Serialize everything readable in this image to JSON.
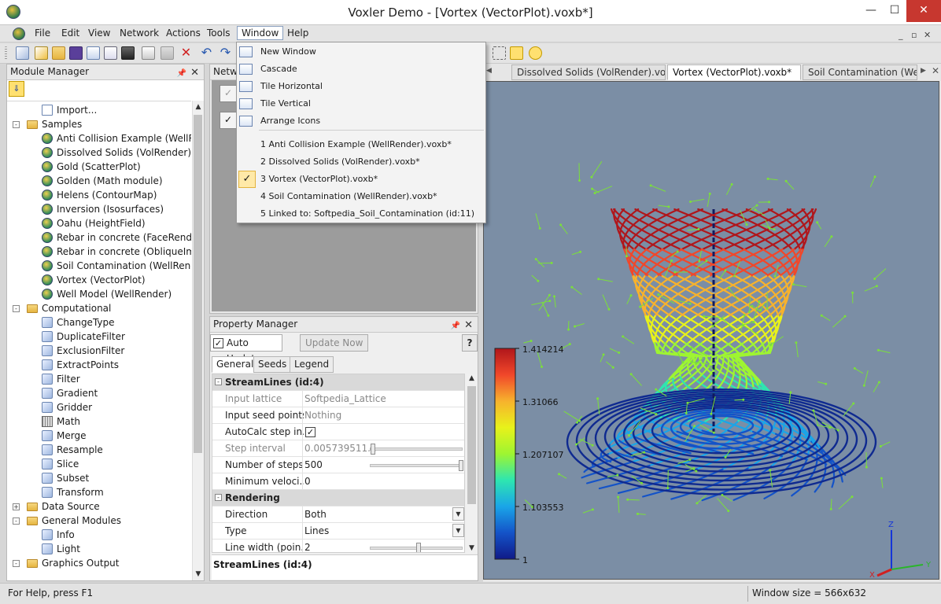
{
  "window": {
    "title": "Voxler Demo - [Vortex (VectorPlot).voxb*]",
    "minimize": "—",
    "maximize": "☐",
    "close": "✕"
  },
  "menu": {
    "items": [
      "File",
      "Edit",
      "View",
      "Network",
      "Actions",
      "Tools",
      "Window",
      "Help"
    ],
    "mdi": {
      "minimize": "_",
      "restore": "▫",
      "close": "✕"
    }
  },
  "window_menu": {
    "items": [
      {
        "label": "New Window",
        "icon": "new-window-icon"
      },
      {
        "label": "Cascade",
        "icon": "cascade-icon"
      },
      {
        "label": "Tile Horizontal",
        "icon": "tile-horizontal-icon"
      },
      {
        "label": "Tile Vertical",
        "icon": "tile-vertical-icon"
      },
      {
        "label": "Arrange Icons",
        "icon": "arrange-icons-icon"
      }
    ],
    "files": [
      "1 Anti Collision Example (WellRender).voxb*",
      "2 Dissolved Solids (VolRender).voxb*",
      "3 Vortex (VectorPlot).voxb*",
      "4 Soil Contamination (WellRender).voxb*",
      "5 Linked to: Softpedia_Soil_Contamination (id:11)"
    ],
    "checked": "✓"
  },
  "module_manager": {
    "title": "Module Manager",
    "pin": "📌",
    "close": "✕",
    "tool_icon": "⇓",
    "items": [
      {
        "label": "Import...",
        "type": "file",
        "level": 1,
        "exp": ""
      },
      {
        "label": "Samples",
        "type": "folder",
        "level": 0,
        "exp": "-"
      },
      {
        "label": "Anti Collision Example (WellRen",
        "type": "sample",
        "level": 1,
        "exp": ""
      },
      {
        "label": "Dissolved Solids (VolRender)",
        "type": "sample",
        "level": 1,
        "exp": ""
      },
      {
        "label": "Gold (ScatterPlot)",
        "type": "sample",
        "level": 1,
        "exp": ""
      },
      {
        "label": "Golden (Math module)",
        "type": "sample",
        "level": 1,
        "exp": ""
      },
      {
        "label": "Helens (ContourMap)",
        "type": "sample",
        "level": 1,
        "exp": ""
      },
      {
        "label": "Inversion (Isosurfaces)",
        "type": "sample",
        "level": 1,
        "exp": ""
      },
      {
        "label": "Oahu (HeightField)",
        "type": "sample",
        "level": 1,
        "exp": ""
      },
      {
        "label": "Rebar in concrete (FaceRender)",
        "type": "sample",
        "level": 1,
        "exp": ""
      },
      {
        "label": "Rebar in concrete (ObliqueImag",
        "type": "sample",
        "level": 1,
        "exp": ""
      },
      {
        "label": "Soil Contamination (WellRender",
        "type": "sample",
        "level": 1,
        "exp": ""
      },
      {
        "label": "Vortex (VectorPlot)",
        "type": "sample",
        "level": 1,
        "exp": ""
      },
      {
        "label": "Well Model (WellRender)",
        "type": "sample",
        "level": 1,
        "exp": ""
      },
      {
        "label": "Computational",
        "type": "folder",
        "level": 0,
        "exp": "-"
      },
      {
        "label": "ChangeType",
        "type": "module",
        "level": 1,
        "exp": ""
      },
      {
        "label": "DuplicateFilter",
        "type": "module",
        "level": 1,
        "exp": ""
      },
      {
        "label": "ExclusionFilter",
        "type": "module",
        "level": 1,
        "exp": ""
      },
      {
        "label": "ExtractPoints",
        "type": "module",
        "level": 1,
        "exp": ""
      },
      {
        "label": "Filter",
        "type": "module",
        "level": 1,
        "exp": ""
      },
      {
        "label": "Gradient",
        "type": "module",
        "level": 1,
        "exp": ""
      },
      {
        "label": "Gridder",
        "type": "module",
        "level": 1,
        "exp": ""
      },
      {
        "label": "Math",
        "type": "grid",
        "level": 1,
        "exp": ""
      },
      {
        "label": "Merge",
        "type": "module",
        "level": 1,
        "exp": ""
      },
      {
        "label": "Resample",
        "type": "module",
        "level": 1,
        "exp": ""
      },
      {
        "label": "Slice",
        "type": "module",
        "level": 1,
        "exp": ""
      },
      {
        "label": "Subset",
        "type": "module",
        "level": 1,
        "exp": ""
      },
      {
        "label": "Transform",
        "type": "module",
        "level": 1,
        "exp": ""
      },
      {
        "label": "Data Source",
        "type": "folder",
        "level": 0,
        "exp": "+"
      },
      {
        "label": "General Modules",
        "type": "folder",
        "level": 0,
        "exp": "-"
      },
      {
        "label": "Info",
        "type": "module",
        "level": 1,
        "exp": ""
      },
      {
        "label": "Light",
        "type": "module",
        "level": 1,
        "exp": ""
      },
      {
        "label": "Graphics Output",
        "type": "folder",
        "level": 0,
        "exp": "-"
      }
    ]
  },
  "network_manager": {
    "title": "Netwo",
    "check": "✓"
  },
  "property_manager": {
    "title": "Property Manager",
    "pin": "📌",
    "close": "✕",
    "auto_update": "Auto Update",
    "auto_update_check": "✓",
    "update_now": "Update Now",
    "help": "?",
    "tabs": [
      "General",
      "Seeds",
      "Legend"
    ],
    "sections": {
      "streamlines": "StreamLines (id:4)",
      "rendering": "Rendering"
    },
    "rows": {
      "input_lattice": {
        "k": "Input lattice",
        "v": "Softpedia_Lattice"
      },
      "input_seed": {
        "k": "Input seed points",
        "v": "Nothing"
      },
      "autocalc": {
        "k": "AutoCalc step in...",
        "v": "✓"
      },
      "step_interval": {
        "k": "Step interval",
        "v": "0.005739511..."
      },
      "num_steps": {
        "k": "Number of steps",
        "v": "500"
      },
      "min_velocity": {
        "k": "Minimum veloci...",
        "v": "0"
      },
      "direction": {
        "k": "Direction",
        "v": "Both"
      },
      "type": {
        "k": "Type",
        "v": "Lines"
      },
      "line_width": {
        "k": "Line width (poin...",
        "v": "2"
      }
    },
    "description": "StreamLines (id:4)"
  },
  "viewer": {
    "tabs": [
      "Dissolved Solids (VolRender).voxb*",
      "Vortex (VectorPlot).voxb*",
      "Soil Contamination (Well..."
    ],
    "colorbar": {
      "labels": [
        "1.414214",
        "1.31066",
        "1.207107",
        "1.103553",
        "1"
      ],
      "colors": [
        "#b0161b",
        "#f1472a",
        "#f7b22d",
        "#e8f21a",
        "#9ef531",
        "#2ee6b0",
        "#1aa5e8",
        "#1453c8",
        "#101a88"
      ]
    },
    "axis": {
      "z": "Z",
      "y": "Y",
      "x": "X"
    }
  },
  "status": {
    "help": "For Help, press F1",
    "size": "Window size = 566x632"
  }
}
